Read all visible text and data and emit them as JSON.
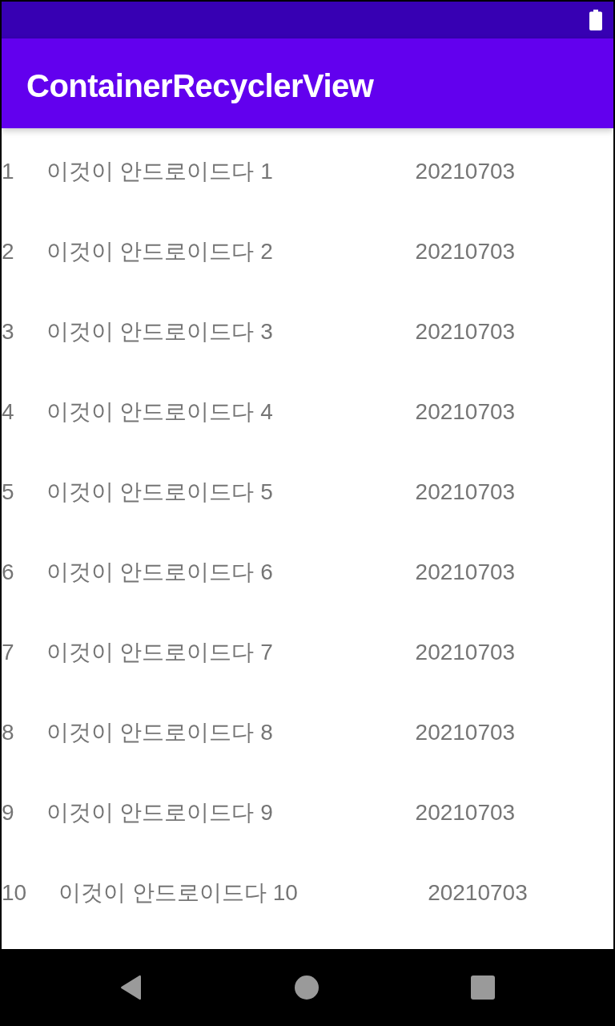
{
  "app_bar": {
    "title": "ContainerRecyclerView"
  },
  "list": {
    "rows": [
      {
        "number": "1",
        "title": "이것이 안드로이드다 1",
        "date": "20210703"
      },
      {
        "number": "2",
        "title": "이것이 안드로이드다 2",
        "date": "20210703"
      },
      {
        "number": "3",
        "title": "이것이 안드로이드다 3",
        "date": "20210703"
      },
      {
        "number": "4",
        "title": "이것이 안드로이드다 4",
        "date": "20210703"
      },
      {
        "number": "5",
        "title": "이것이 안드로이드다 5",
        "date": "20210703"
      },
      {
        "number": "6",
        "title": "이것이 안드로이드다 6",
        "date": "20210703"
      },
      {
        "number": "7",
        "title": "이것이 안드로이드다 7",
        "date": "20210703"
      },
      {
        "number": "8",
        "title": "이것이 안드로이드다 8",
        "date": "20210703"
      },
      {
        "number": "9",
        "title": "이것이 안드로이드다 9",
        "date": "20210703"
      },
      {
        "number": "10",
        "title": "이것이 안드로이드다 10",
        "date": "20210703"
      }
    ]
  }
}
